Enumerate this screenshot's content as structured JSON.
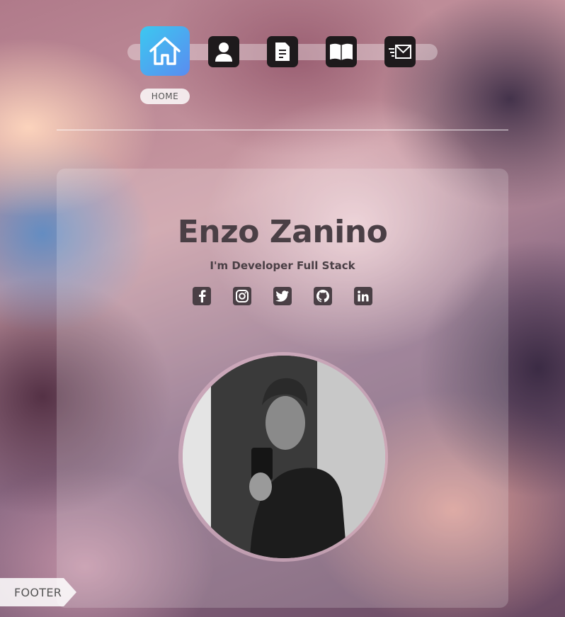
{
  "nav": {
    "items": [
      {
        "id": "home",
        "icon": "home-icon",
        "active": true
      },
      {
        "id": "about",
        "icon": "user-icon",
        "active": false
      },
      {
        "id": "resume",
        "icon": "document-icon",
        "active": false
      },
      {
        "id": "portfolio",
        "icon": "book-icon",
        "active": false
      },
      {
        "id": "contact",
        "icon": "mail-icon",
        "active": false
      }
    ],
    "active_label": "HOME"
  },
  "profile": {
    "name": "Enzo Zanino",
    "tagline": "I'm Developer Full Stack"
  },
  "socials": [
    {
      "icon": "facebook-icon"
    },
    {
      "icon": "instagram-icon"
    },
    {
      "icon": "twitter-icon"
    },
    {
      "icon": "github-icon"
    },
    {
      "icon": "linkedin-icon"
    }
  ],
  "footer": {
    "label": "FOOTER"
  },
  "colors": {
    "accent_gradient_start": "#3cc8f0",
    "accent_gradient_end": "#5a8cf0",
    "text": "#4a3f45",
    "icon_bg": "#1e1a1c"
  }
}
